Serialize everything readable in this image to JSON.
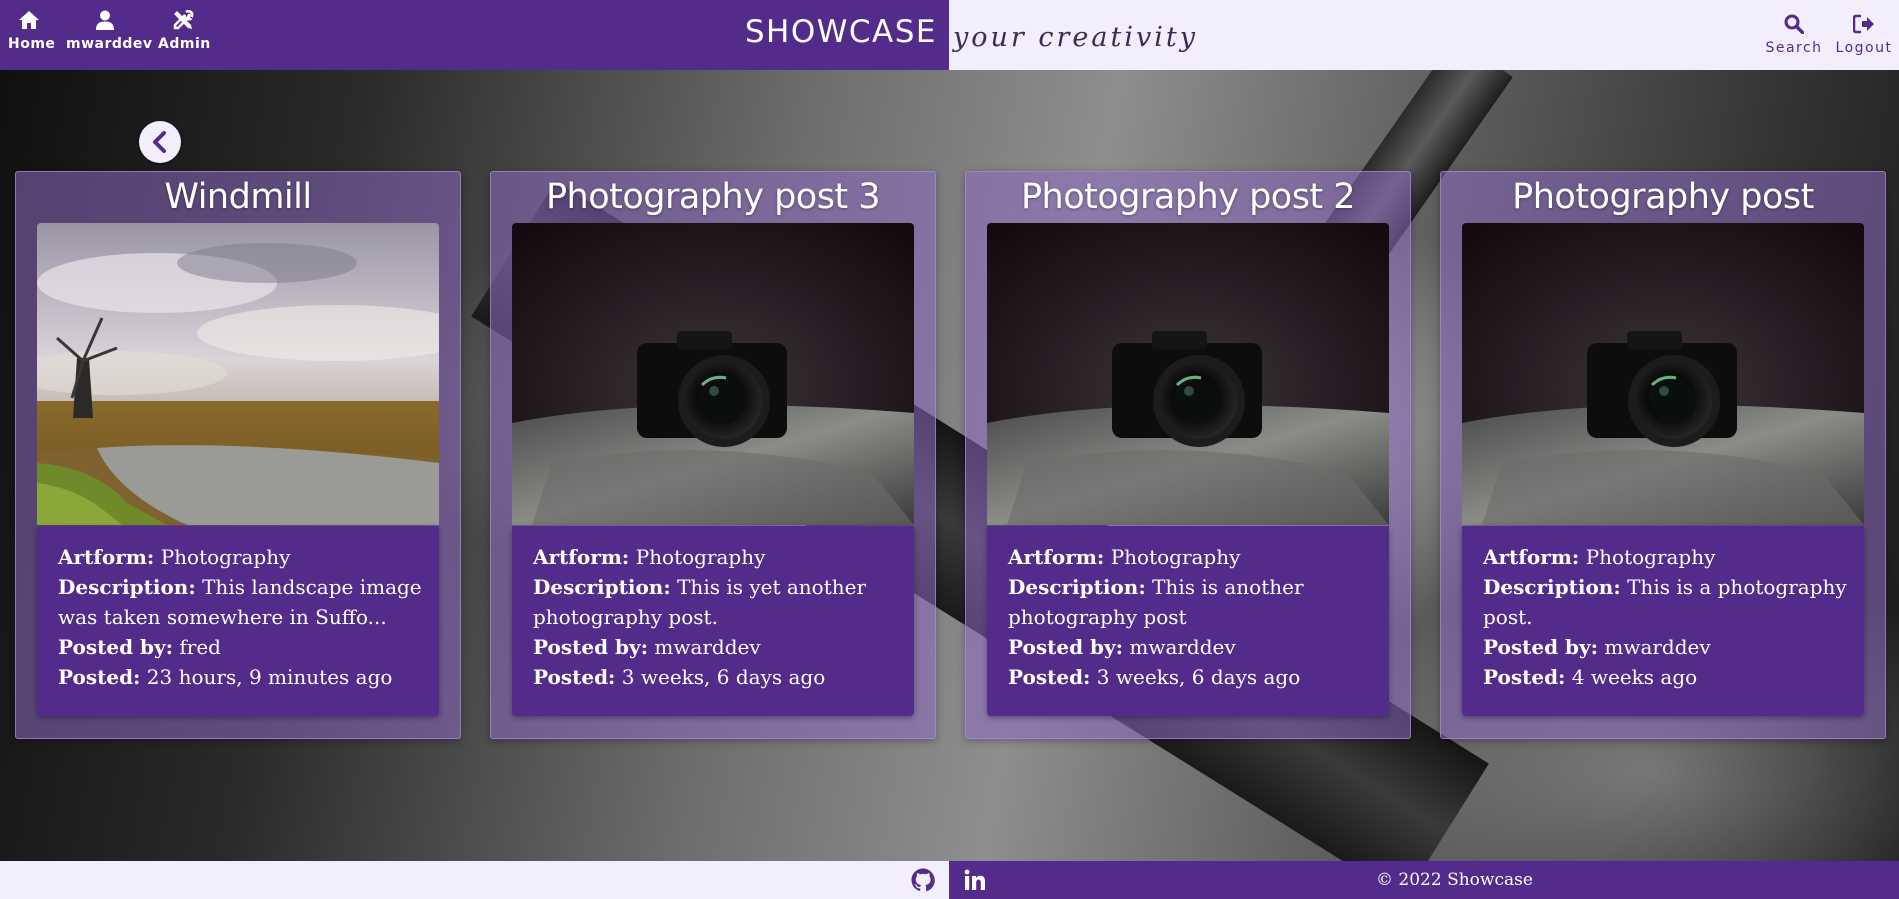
{
  "nav": {
    "home": {
      "label": "Home",
      "icon": "home-icon"
    },
    "user": {
      "label": "mwarddev",
      "icon": "user-icon"
    },
    "admin": {
      "label": "Admin",
      "icon": "tools-icon"
    },
    "search": {
      "label": "Search",
      "icon": "search-icon"
    },
    "logout": {
      "label": "Logout",
      "icon": "logout-icon"
    }
  },
  "brand": {
    "name": "SHOWCASE",
    "tagline": "your creativity"
  },
  "colors": {
    "primary": "#532b8a",
    "light": "#f3eefb",
    "card_overlay": "rgba(140,105,195,0.55)"
  },
  "back_button": {
    "icon": "chevron-left-icon"
  },
  "posts": [
    {
      "title": "Windmill",
      "image": "windmill-landscape-photo",
      "artform_label": "Artform:",
      "artform": "Photography",
      "description_label": "Description:",
      "description": "This landscape image was taken somewhere in Suffo...",
      "posted_by_label": "Posted by:",
      "posted_by": "fred",
      "posted_label": "Posted:",
      "posted": "23 hours, 9 minutes ago"
    },
    {
      "title": "Photography post 3",
      "image": "camera-photo",
      "artform_label": "Artform:",
      "artform": "Photography",
      "description_label": "Description:",
      "description": "This is yet another photography post.",
      "posted_by_label": "Posted by:",
      "posted_by": "mwarddev",
      "posted_label": "Posted:",
      "posted": "3 weeks, 6 days ago"
    },
    {
      "title": "Photography post 2",
      "image": "camera-photo",
      "artform_label": "Artform:",
      "artform": "Photography",
      "description_label": "Description:",
      "description": "This is another photography post",
      "posted_by_label": "Posted by:",
      "posted_by": "mwarddev",
      "posted_label": "Posted:",
      "posted": "3 weeks, 6 days ago"
    },
    {
      "title": "Photography post",
      "image": "camera-photo",
      "artform_label": "Artform:",
      "artform": "Photography",
      "description_label": "Description:",
      "description": "This is a photography post.",
      "posted_by_label": "Posted by:",
      "posted_by": "mwarddev",
      "posted_label": "Posted:",
      "posted": "4 weeks ago"
    }
  ],
  "footer": {
    "github_icon": "github-icon",
    "linkedin_icon": "linkedin-icon",
    "copyright": "© 2022 Showcase"
  }
}
